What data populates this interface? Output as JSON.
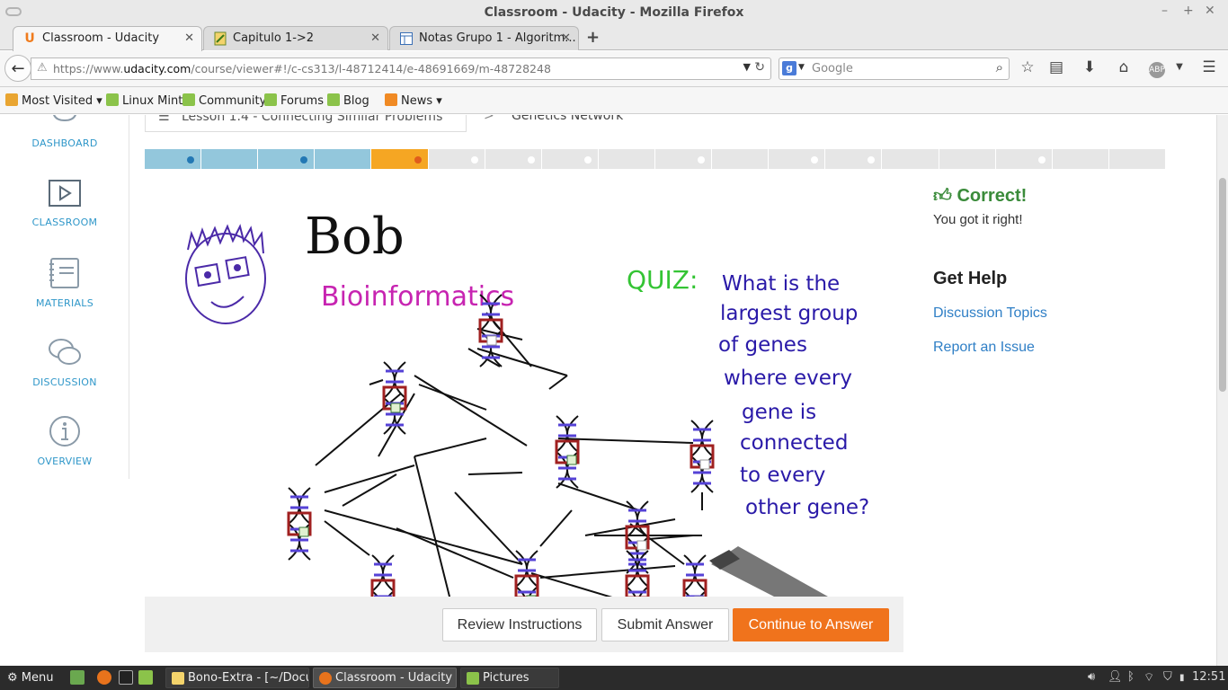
{
  "window": {
    "title": "Classroom - Udacity - Mozilla Firefox",
    "minimize": "–",
    "maximize": "+",
    "close": "✕"
  },
  "tabs": [
    {
      "label": "Classroom - Udacity",
      "icon": "udacity-icon",
      "icon_text": "U",
      "active": true
    },
    {
      "label": "Capitulo 1->2",
      "icon": "document-icon",
      "active": false
    },
    {
      "label": "Notas Grupo 1 - Algoritm...",
      "icon": "spreadsheet-icon",
      "active": false
    }
  ],
  "tab_close": "✕",
  "new_tab": "+",
  "url": {
    "prefix": "https://www.",
    "domain": "udacity.com",
    "path": "/course/viewer#!/c-cs313/l-48712414/e-48691669/m-48728248"
  },
  "search": {
    "placeholder": "Google",
    "engine_letter": "g"
  },
  "bookmarks": [
    {
      "label": "Most Visited",
      "icon": "star-folder-icon",
      "dropdown": true
    },
    {
      "label": "Linux Mint",
      "icon": "mint-icon"
    },
    {
      "label": "Community",
      "icon": "mint-icon"
    },
    {
      "label": "Forums",
      "icon": "mint-icon"
    },
    {
      "label": "Blog",
      "icon": "mint-icon"
    },
    {
      "label": "News",
      "icon": "rss-icon",
      "dropdown": true
    }
  ],
  "leftnav": [
    {
      "label": "DASHBOARD",
      "icon": "dashboard-icon"
    },
    {
      "label": "CLASSROOM",
      "icon": "play-icon"
    },
    {
      "label": "MATERIALS",
      "icon": "notebook-icon"
    },
    {
      "label": "DISCUSSION",
      "icon": "chat-bubbles-icon"
    },
    {
      "label": "OVERVIEW",
      "icon": "info-icon"
    }
  ],
  "breadcrumb": {
    "lesson": "Lesson 1.4 - Connecting Similar Problems",
    "separator": ">",
    "current": "Genetics Network"
  },
  "progress": {
    "segments": [
      {
        "state": "done",
        "dot": true
      },
      {
        "state": "done",
        "dot": false
      },
      {
        "state": "done",
        "dot": true
      },
      {
        "state": "done",
        "dot": false
      },
      {
        "state": "current",
        "dot": true
      },
      {
        "state": "todo",
        "dot": true
      },
      {
        "state": "todo",
        "dot": true
      },
      {
        "state": "todo",
        "dot": true
      },
      {
        "state": "todo",
        "dot": false
      },
      {
        "state": "todo",
        "dot": true
      },
      {
        "state": "todo",
        "dot": false
      },
      {
        "state": "todo",
        "dot": true
      },
      {
        "state": "todo",
        "dot": true
      },
      {
        "state": "todo",
        "dot": false
      },
      {
        "state": "todo",
        "dot": false
      },
      {
        "state": "todo",
        "dot": true
      },
      {
        "state": "todo",
        "dot": false
      },
      {
        "state": "todo",
        "dot": false
      }
    ]
  },
  "whiteboard": {
    "name": "Bob",
    "subject": "Bioinformatics",
    "quiz_label": "QUIZ:",
    "quiz_lines": [
      "What is the",
      "largest group",
      "of genes",
      "where every",
      "gene is",
      "connected",
      "to every",
      "other gene?"
    ]
  },
  "buttons": {
    "review": "Review Instructions",
    "submit": "Submit Answer",
    "continue": "Continue to Answer"
  },
  "feedback": {
    "title": "Correct!",
    "message": "You got it right!",
    "help_title": "Get Help",
    "links": [
      "Discussion Topics",
      "Report an Issue"
    ]
  },
  "colors": {
    "accent_blue": "#2f97c9",
    "progress_done": "#93c7dc",
    "progress_current": "#f5a623",
    "continue_orange": "#f0731c",
    "correct_green": "#3a8b3a",
    "link_blue": "#2f7fc6"
  },
  "taskbar": {
    "menu": "Menu",
    "windows": [
      {
        "label": "Bono-Extra - [~/Docu...",
        "active": false
      },
      {
        "label": "Classroom - Udacity -...",
        "active": true
      },
      {
        "label": "Pictures",
        "active": false
      }
    ],
    "clock": "12:51"
  }
}
